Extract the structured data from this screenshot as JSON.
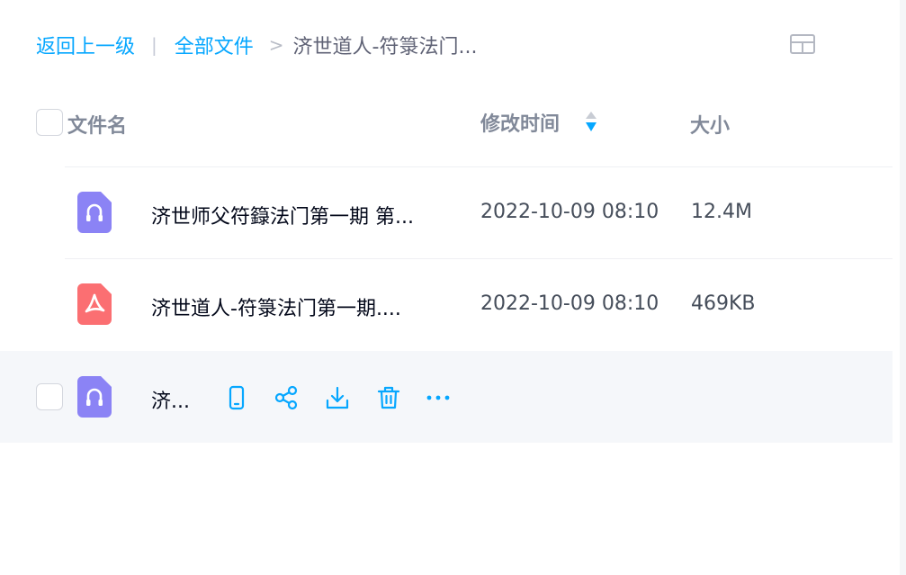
{
  "breadcrumb": {
    "back": "返回上一级",
    "separator": "|",
    "root": "全部文件",
    "arrow": ">",
    "current": "济世道人-符箓法门..."
  },
  "columns": {
    "name": "文件名",
    "modified": "修改时间",
    "size": "大小"
  },
  "files": [
    {
      "name": "济世师父符籙法门第一期 第...",
      "modified": "2022-10-09 08:10",
      "size": "12.4M",
      "icon": "audio-file-icon"
    },
    {
      "name": "济世道人-符箓法门第一期....",
      "modified": "2022-10-09 08:10",
      "size": "469KB",
      "icon": "pdf-file-icon"
    },
    {
      "name": "济...",
      "modified": "",
      "size": "",
      "icon": "audio-file-icon"
    }
  ],
  "row_actions": [
    "phone-icon",
    "share-icon",
    "download-icon",
    "delete-icon",
    "more-icon"
  ],
  "colors": {
    "accent": "#06a7ff",
    "audio_icon": "#8b83f5",
    "pdf_icon": "#fb6f72",
    "hover_row": "#f5f7fa"
  }
}
